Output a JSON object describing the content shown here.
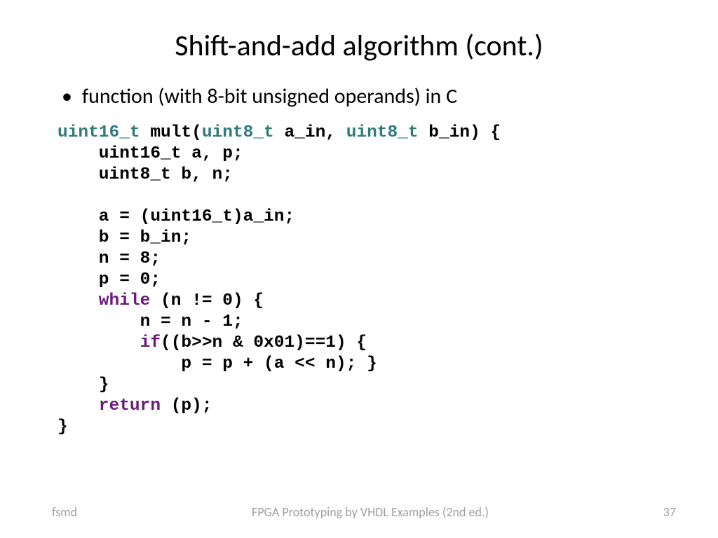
{
  "title": "Shift-and-add algorithm (cont.)",
  "bullet": "function (with 8-bit unsigned operands) in C",
  "code": {
    "t_uint16": "uint16_t",
    "t_uint8": "uint8_t",
    "fn_name": " mult(",
    "arg1": " a_in, ",
    "arg2": " b_in) {",
    "decl1": "    uint16_t a, p;",
    "decl2": "    uint8_t b, n;",
    "blank": " ",
    "s1": "    a = (uint16_t)a_in;",
    "s2": "    b = b_in;",
    "s3": "    n = 8;",
    "s4": "    p = 0;",
    "kw_while": "    while",
    "while_cond": " (n != 0) {",
    "w1": "        n = n - 1;",
    "kw_if": "        if",
    "if_rest": "((b>>n & 0x01)==1) {",
    "if_body": "            p = p + (a << n); }",
    "close_while": "    }",
    "kw_return": "    return",
    "ret_rest": " (p);",
    "close_fn": "}"
  },
  "footer": {
    "left": "fsmd",
    "mid": "FPGA Prototyping by VHDL Examples (2nd ed.)",
    "right": "37"
  }
}
